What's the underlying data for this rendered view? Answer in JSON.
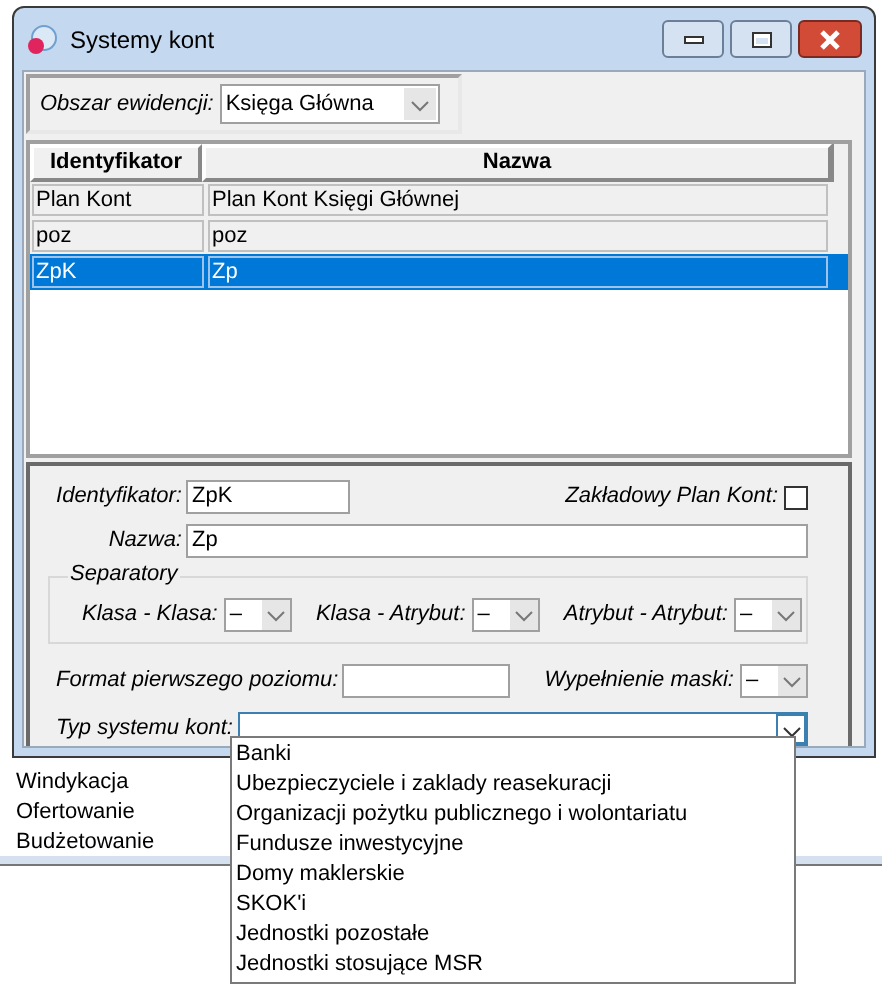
{
  "window": {
    "title": "Systemy kont"
  },
  "area": {
    "label": "Obszar ewidencji:",
    "value": "Księga Główna"
  },
  "table": {
    "columns": [
      "Identyfikator",
      "Nazwa"
    ],
    "rows": [
      {
        "cells": [
          "Plan Kont",
          "Plan Kont Księgi Głównej"
        ],
        "selected": false
      },
      {
        "cells": [
          "poz",
          "poz"
        ],
        "selected": false
      },
      {
        "cells": [
          "ZpK",
          "Zp"
        ],
        "selected": true
      }
    ]
  },
  "form": {
    "identifier": {
      "label": "Identyfikator:",
      "value": "ZpK"
    },
    "default_plan": {
      "label": "Zakładowy Plan Kont:",
      "checked": false
    },
    "name": {
      "label": "Nazwa:",
      "value": "Zp"
    },
    "separators": {
      "title": "Separatory",
      "fields": [
        {
          "label": "Klasa - Klasa:",
          "value": "–"
        },
        {
          "label": "Klasa - Atrybut:",
          "value": "–"
        },
        {
          "label": "Atrybut - Atrybut:",
          "value": "–"
        }
      ]
    },
    "format": {
      "label": "Format pierwszego poziomu:"
    },
    "mask": {
      "label": "Wypełnienie maski:",
      "value": "–"
    },
    "type": {
      "label": "Typ systemu kont:",
      "expanded": true,
      "options": [
        "Banki",
        "Ubezpieczyciele i zaklady reasekuracji",
        "Organizacji pożytku publicznego i wolontariatu",
        "Fundusze inwestycyjne",
        "Domy maklerskie",
        "SKOK'i",
        "Jednostki pozostałe",
        "Jednostki stosujące MSR"
      ]
    }
  },
  "background_list": [
    "Windykacja",
    "Ofertowanie",
    "Budżetowanie"
  ]
}
